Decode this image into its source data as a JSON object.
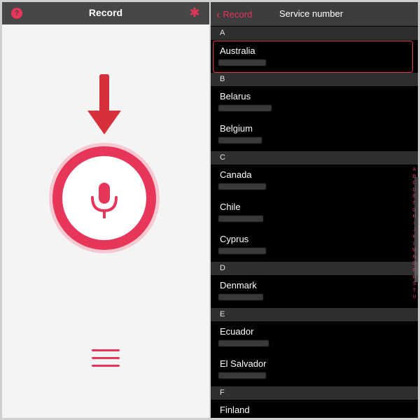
{
  "left": {
    "title": "Record",
    "help_glyph": "?",
    "gear_glyph": "✱",
    "accent": "#e8355a"
  },
  "right": {
    "back_label": "Record",
    "title": "Service number",
    "sections": [
      {
        "letter": "A",
        "items": [
          "Australia"
        ]
      },
      {
        "letter": "B",
        "items": [
          "Belarus",
          "Belgium"
        ]
      },
      {
        "letter": "C",
        "items": [
          "Canada",
          "Chile",
          "Cyprus"
        ]
      },
      {
        "letter": "D",
        "items": [
          "Denmark"
        ]
      },
      {
        "letter": "E",
        "items": [
          "Ecuador",
          "El Salvador"
        ]
      },
      {
        "letter": "F",
        "items": [
          "Finland"
        ]
      }
    ],
    "selected": "Australia",
    "index_letters": [
      "A",
      "B",
      "C",
      "D",
      "E",
      "F",
      "G",
      "H",
      "I",
      "J",
      "K",
      "L",
      "M",
      "N",
      "O",
      "P",
      "R",
      "S",
      "T",
      "U"
    ]
  }
}
